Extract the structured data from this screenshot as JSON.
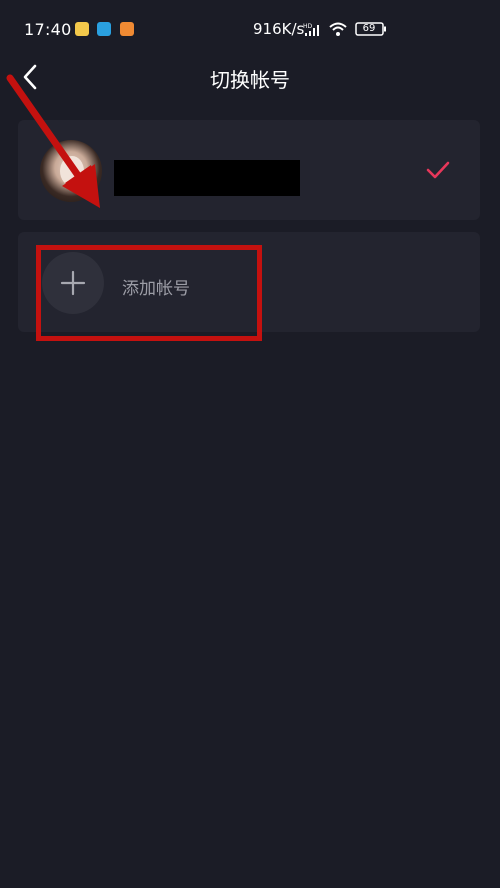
{
  "status_bar": {
    "time": "17:40",
    "network_speed": "916K/s",
    "battery": "69"
  },
  "header": {
    "title": "切换帐号"
  },
  "account": {
    "selected": true
  },
  "add_account": {
    "label": "添加帐号"
  },
  "colors": {
    "background": "#1b1c26",
    "card": "#23242f",
    "check": "#e6375a",
    "annotation_red": "#c4110f"
  },
  "icons": {
    "back": "chevron-left-icon",
    "check": "checkmark-icon",
    "add": "plus-icon",
    "wifi": "wifi-icon",
    "signal": "signal-icon",
    "battery": "battery-icon"
  }
}
